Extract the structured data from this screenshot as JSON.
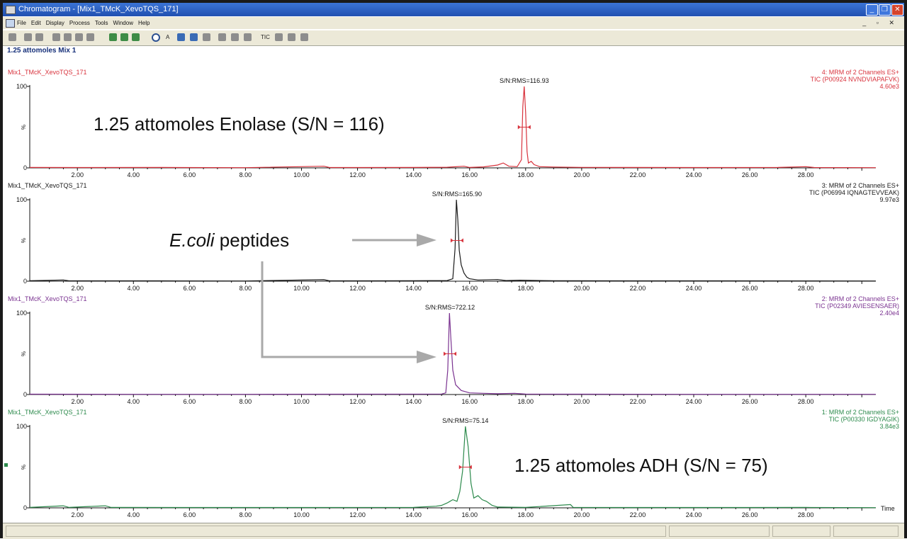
{
  "window": {
    "title": "Chromatogram - [Mix1_TMcK_XevoTQS_171]",
    "menu": [
      "File",
      "Edit",
      "Display",
      "Process",
      "Tools",
      "Window",
      "Help"
    ],
    "buttons": {
      "minimize": "_",
      "restore": "❐",
      "close": "✕"
    },
    "mdi_buttons": "_ ▫ ✕"
  },
  "toolbar": {
    "tic_label": "TIC"
  },
  "chart_title": "1.25 attomoles Mix 1",
  "chart_data": {
    "type": "line",
    "xlabel": "Time",
    "xlim": [
      0.3,
      30.5
    ],
    "ylim": [
      0,
      100
    ],
    "xticks": [
      "2.00",
      "4.00",
      "6.00",
      "8.00",
      "10.00",
      "12.00",
      "14.00",
      "16.00",
      "18.00",
      "20.00",
      "22.00",
      "24.00",
      "26.00",
      "28.00"
    ],
    "yticks": [
      "0",
      "%",
      "100"
    ],
    "annotations": [
      {
        "text": "1.25 attomoles Enolase (S/N = 116)",
        "panel": 0
      },
      {
        "text_italic": "E.coli",
        "text": "peptides",
        "panel": 1
      },
      {
        "text": "1.25 attomoles ADH (S/N = 75)",
        "panel": 3
      }
    ],
    "panels": [
      {
        "sample": "Mix1_TMcK_XevoTQS_171",
        "header": [
          "4: MRM of 2 Channels ES+",
          "TIC (P00924 NVNDVIAPAFVK)",
          "4.60e3"
        ],
        "color": "#d8333d",
        "peak_label": "S/N:RMS=116.93",
        "peak_rt": 17.95,
        "points": [
          [
            0.3,
            0.5
          ],
          [
            2.0,
            0.4
          ],
          [
            5.0,
            0.5
          ],
          [
            8.0,
            0.3
          ],
          [
            10.8,
            2
          ],
          [
            11.0,
            0.4
          ],
          [
            14.0,
            0.5
          ],
          [
            15.2,
            0.8
          ],
          [
            15.8,
            2
          ],
          [
            16.0,
            0.5
          ],
          [
            16.5,
            1.2
          ],
          [
            17.0,
            3.5
          ],
          [
            17.2,
            6
          ],
          [
            17.4,
            2
          ],
          [
            17.7,
            1.5
          ],
          [
            17.85,
            10
          ],
          [
            17.9,
            75
          ],
          [
            17.95,
            100
          ],
          [
            18.0,
            68
          ],
          [
            18.05,
            20
          ],
          [
            18.1,
            6
          ],
          [
            18.2,
            8
          ],
          [
            18.3,
            4
          ],
          [
            18.5,
            1.5
          ],
          [
            19.0,
            1
          ],
          [
            20.0,
            0.6
          ],
          [
            24.0,
            0.4
          ],
          [
            27.0,
            0.5
          ],
          [
            28.0,
            1.5
          ],
          [
            28.3,
            0.4
          ],
          [
            30.5,
            0.3
          ]
        ]
      },
      {
        "sample": "Mix1_TMcK_XevoTQS_171",
        "header": [
          "3: MRM of 2 Channels ES+",
          "TIC (P06994 IQNAGTEVVEAK)",
          "9.97e3"
        ],
        "color": "#1a1a1a",
        "peak_label": "S/N:RMS=165.90",
        "peak_rt": 15.55,
        "points": [
          [
            0.3,
            0.5
          ],
          [
            1.5,
            1.5
          ],
          [
            1.7,
            0.4
          ],
          [
            5.0,
            0.4
          ],
          [
            8.0,
            0.3
          ],
          [
            10.8,
            1.8
          ],
          [
            11.0,
            0.4
          ],
          [
            14.0,
            0.5
          ],
          [
            15.2,
            0.8
          ],
          [
            15.4,
            3
          ],
          [
            15.48,
            40
          ],
          [
            15.53,
            100
          ],
          [
            15.58,
            75
          ],
          [
            15.63,
            38
          ],
          [
            15.7,
            20
          ],
          [
            15.8,
            10
          ],
          [
            15.9,
            5
          ],
          [
            16.0,
            3
          ],
          [
            16.3,
            1.5
          ],
          [
            17.0,
            2
          ],
          [
            17.3,
            0.8
          ],
          [
            17.8,
            1.2
          ],
          [
            19.0,
            0.5
          ],
          [
            24.0,
            0.4
          ],
          [
            30.5,
            0.3
          ]
        ]
      },
      {
        "sample": "Mix1_TMcK_XevoTQS_171",
        "header": [
          "2: MRM of 2 Channels ES+",
          "TIC (P02349 AVIESENSAER)",
          "2.40e4"
        ],
        "color": "#7a3290",
        "peak_label": "S/N:RMS=722.12",
        "peak_rt": 15.3,
        "points": [
          [
            0.3,
            0.4
          ],
          [
            4.0,
            0.3
          ],
          [
            8.0,
            0.3
          ],
          [
            12.0,
            0.4
          ],
          [
            15.0,
            0.6
          ],
          [
            15.15,
            2
          ],
          [
            15.22,
            30
          ],
          [
            15.28,
            100
          ],
          [
            15.33,
            70
          ],
          [
            15.4,
            30
          ],
          [
            15.5,
            12
          ],
          [
            15.7,
            5
          ],
          [
            16.0,
            2
          ],
          [
            16.5,
            1.5
          ],
          [
            17.0,
            1
          ],
          [
            17.6,
            1.5
          ],
          [
            18.0,
            0.5
          ],
          [
            20.0,
            0.4
          ],
          [
            24.0,
            0.3
          ],
          [
            30.5,
            0.3
          ]
        ]
      },
      {
        "sample": "Mix1_TMcK_XevoTQS_171",
        "header": [
          "1: MRM of 2 Channels ES+",
          "TIC (P00330 IGDYAGIK)",
          "3.84e3"
        ],
        "color": "#2c8a4c",
        "peak_label": "S/N:RMS=75.14",
        "peak_rt": 15.85,
        "points": [
          [
            0.3,
            0.5
          ],
          [
            1.5,
            2.5
          ],
          [
            1.7,
            0.5
          ],
          [
            3.0,
            2.5
          ],
          [
            3.2,
            0.5
          ],
          [
            6.0,
            0.4
          ],
          [
            10.0,
            0.4
          ],
          [
            14.0,
            0.5
          ],
          [
            14.8,
            2
          ],
          [
            15.0,
            3
          ],
          [
            15.2,
            6
          ],
          [
            15.4,
            10
          ],
          [
            15.55,
            8
          ],
          [
            15.65,
            20
          ],
          [
            15.75,
            45
          ],
          [
            15.85,
            100
          ],
          [
            15.95,
            75
          ],
          [
            16.05,
            30
          ],
          [
            16.15,
            12
          ],
          [
            16.3,
            15
          ],
          [
            16.45,
            10
          ],
          [
            16.6,
            8
          ],
          [
            16.8,
            3
          ],
          [
            17.0,
            1
          ],
          [
            18.0,
            0.5
          ],
          [
            19.6,
            4
          ],
          [
            19.7,
            0.5
          ],
          [
            22.0,
            0.4
          ],
          [
            26.0,
            0.4
          ],
          [
            28.0,
            0.5
          ],
          [
            30.5,
            0.3
          ]
        ]
      }
    ]
  }
}
